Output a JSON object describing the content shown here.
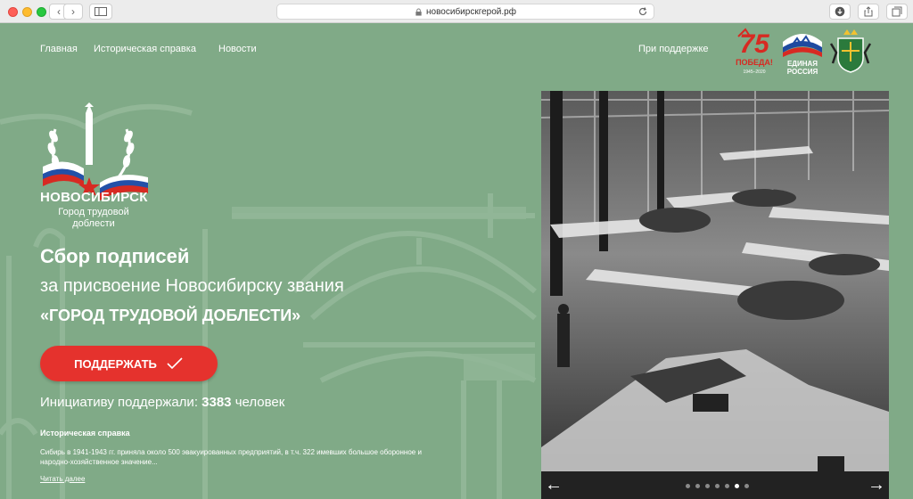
{
  "browser": {
    "url": "новосибирскгерой.рф",
    "back_glyph": "‹",
    "forward_glyph": "›"
  },
  "nav": {
    "items": [
      "Главная",
      "Историческая справка",
      "Новости"
    ],
    "support_label": "При поддержке"
  },
  "partners": {
    "pobeda_number": "75",
    "pobeda_label": "ПОБЕДА!",
    "pobeda_years": "1945–2020",
    "er_line1": "ЕДИНАЯ",
    "er_line2": "РОССИЯ"
  },
  "hero": {
    "city": "НОВОСИБИРСК",
    "city_sub": "Город трудовой доблести",
    "title": "Сбор подписей",
    "subtitle": "за присвоение Новосибирску звания",
    "honor": "«ГОРОД ТРУДОВОЙ ДОБЛЕСТИ»",
    "cta_label": "ПОДДЕРЖАТЬ",
    "counter_prefix": "Инициативу поддержали:",
    "counter_value": "3383",
    "counter_suffix": "человек"
  },
  "history": {
    "title": "Историческая справка",
    "text": "Сибирь в 1941-1943 гг. приняла около 500 эвакуированных предприятий, в т.ч. 322 имевших большое оборонное и народно-хозяйственное значение...",
    "link": "Читать далее"
  },
  "slider": {
    "prev_glyph": "←",
    "next_glyph": "→",
    "dot_count": 7,
    "active_dot": 5
  },
  "colors": {
    "background": "#80aa87",
    "accent_red": "#e5322d",
    "text": "#ffffff"
  }
}
